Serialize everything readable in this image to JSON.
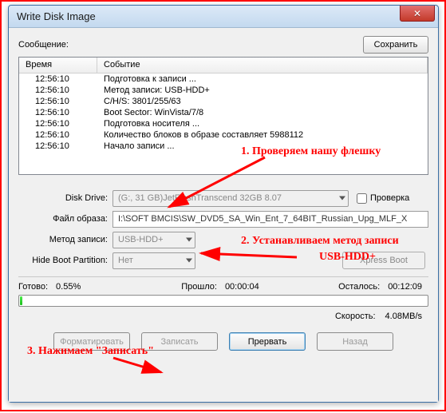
{
  "window": {
    "title": "Write Disk Image"
  },
  "close_glyph": "✕",
  "message_label": "Сообщение:",
  "save_button": "Сохранить",
  "log": {
    "col_time": "Время",
    "col_event": "Событие",
    "rows": [
      {
        "time": "12:56:10",
        "event": "Подготовка к записи ..."
      },
      {
        "time": "12:56:10",
        "event": "Метод записи: USB-HDD+"
      },
      {
        "time": "12:56:10",
        "event": "C/H/S: 3801/255/63"
      },
      {
        "time": "12:56:10",
        "event": "Boot Sector: WinVista/7/8"
      },
      {
        "time": "12:56:10",
        "event": "Подготовка носителя ..."
      },
      {
        "time": "12:56:10",
        "event": "Количество блоков в образе составляет 5988112"
      },
      {
        "time": "12:56:10",
        "event": "Начало записи ..."
      }
    ]
  },
  "labels": {
    "disk_drive": "Disk Drive:",
    "image_file": "Файл образа:",
    "write_method": "Метод записи:",
    "hide_boot": "Hide Boot Partition:",
    "verify": "Проверка",
    "xpress": "Xpress Boot",
    "done": "Готово:",
    "elapsed": "Прошло:",
    "remaining": "Осталось:",
    "speed": "Скорость:"
  },
  "values": {
    "disk_drive": "(G:, 31 GB)JetFlashTranscend 32GB  8.07",
    "image_file": "I:\\SOFT BMCIS\\SW_DVD5_SA_Win_Ent_7_64BIT_Russian_Upg_MLF_X",
    "write_method": "USB-HDD+",
    "hide_boot": "Нет",
    "done_pct": "0.55%",
    "elapsed": "00:00:04",
    "remaining": "00:12:09",
    "speed_val": "4.08MB/s"
  },
  "buttons": {
    "format": "Форматировать",
    "write": "Записать",
    "abort": "Прервать",
    "back": "Назад"
  },
  "annotations": {
    "a1": "1. Проверяем нашу флешку",
    "a2": "2. Устанавливаем метод записи",
    "a2b": "USB-HDD+",
    "a3": "3. Нажимаем \"Записать\""
  }
}
